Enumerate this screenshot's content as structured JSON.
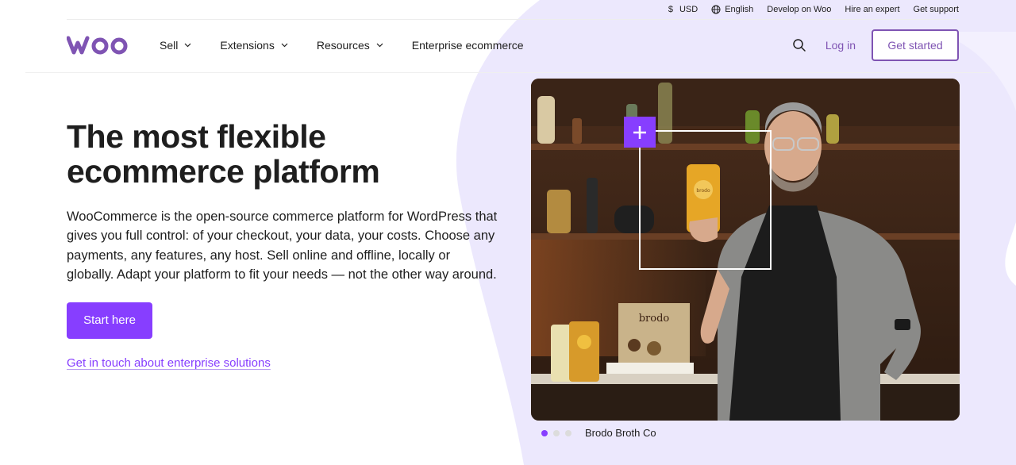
{
  "topbar": {
    "currency": "USD",
    "language": "English",
    "develop": "Develop on Woo",
    "hire": "Hire an expert",
    "support": "Get support"
  },
  "nav": {
    "logo": "woo",
    "sell": "Sell",
    "extensions": "Extensions",
    "resources": "Resources",
    "enterprise": "Enterprise ecommerce",
    "login": "Log in",
    "get_started": "Get started"
  },
  "hero": {
    "title_line1": "The most flexible",
    "title_line2": "ecommerce platform",
    "description": "WooCommerce is the open-source commerce platform for WordPress that gives you full control: of your checkout, your data, your costs. Choose any payments, any features, any host. Sell online and offline, locally or globally. Adapt your platform to fit your needs — not the other way around.",
    "start_button": "Start here",
    "enterprise_link": "Get in touch about enterprise solutions"
  },
  "carousel": {
    "slides": 3,
    "active": 1,
    "caption": "Brodo Broth Co"
  },
  "image": {
    "book_title": "brodo",
    "package_label": "brodo"
  },
  "colors": {
    "accent": "#873eff",
    "brand": "#7f54b3",
    "bg_shape": "#ece8fd",
    "text": "#1e1e1e"
  },
  "icons": {
    "currency": "dollar-icon",
    "language": "globe-icon",
    "search": "search-icon",
    "dropdown": "chevron-down-icon",
    "add": "plus-icon"
  }
}
